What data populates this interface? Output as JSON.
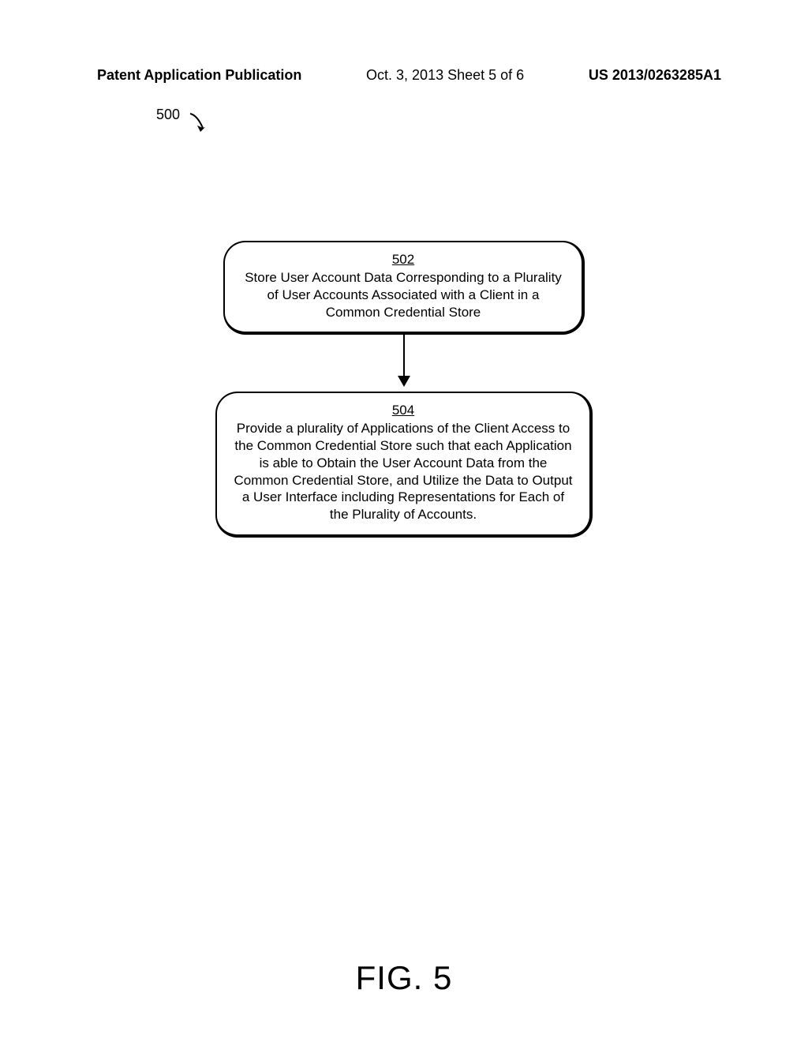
{
  "header": {
    "left": "Patent Application Publication",
    "center": "Oct. 3, 2013  Sheet 5 of 6",
    "right": "US 2013/0263285A1"
  },
  "reference": {
    "number": "500"
  },
  "steps": {
    "s502": {
      "num": "502",
      "text": "Store User Account Data Corresponding to a Plurality of User Accounts Associated with a Client in a Common Credential Store"
    },
    "s504": {
      "num": "504",
      "text": "Provide a plurality of Applications of the Client Access to the Common Credential Store such that each Application is able to Obtain the User Account Data from the Common Credential Store, and Utilize the Data to Output a User Interface including Representations for Each of the Plurality of Accounts."
    }
  },
  "figure": {
    "caption": "FIG. 5"
  }
}
